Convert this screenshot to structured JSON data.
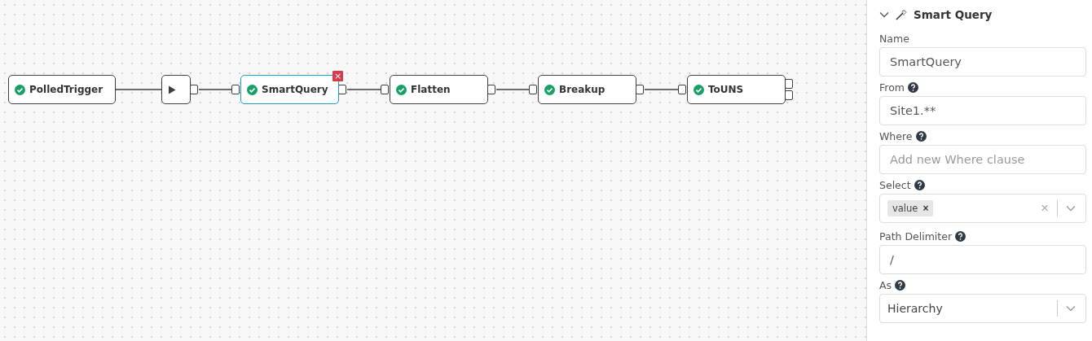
{
  "flow": {
    "nodes": [
      {
        "kind": "trigger",
        "label": "PolledTrigger",
        "valid": true,
        "selected": false
      },
      {
        "kind": "action",
        "valid": false,
        "selected": false
      },
      {
        "kind": "step",
        "label": "SmartQuery",
        "valid": true,
        "selected": true,
        "delete_label": "×"
      },
      {
        "kind": "step",
        "label": "Flatten",
        "valid": true,
        "selected": false
      },
      {
        "kind": "step",
        "label": "Breakup",
        "valid": true,
        "selected": false
      },
      {
        "kind": "sink",
        "label": "ToUNS",
        "valid": true,
        "selected": false
      }
    ]
  },
  "panel": {
    "title": "Smart Query",
    "expanded": true,
    "fields": [
      {
        "kind": "text",
        "label": "Name",
        "help": false,
        "value": "SmartQuery"
      },
      {
        "kind": "text",
        "label": "From",
        "help": true,
        "value": "Site1.**"
      },
      {
        "kind": "text",
        "label": "Where",
        "help": true,
        "placeholder": "Add new Where clause"
      },
      {
        "kind": "multi",
        "label": "Select",
        "help": true,
        "tags": [
          "value"
        ],
        "tag_remove": "×",
        "clear": "×"
      },
      {
        "kind": "text",
        "label": "Path Delimiter",
        "help": true,
        "value": "/"
      },
      {
        "kind": "select",
        "label": "As",
        "help": true,
        "value": "Hierarchy"
      }
    ]
  }
}
